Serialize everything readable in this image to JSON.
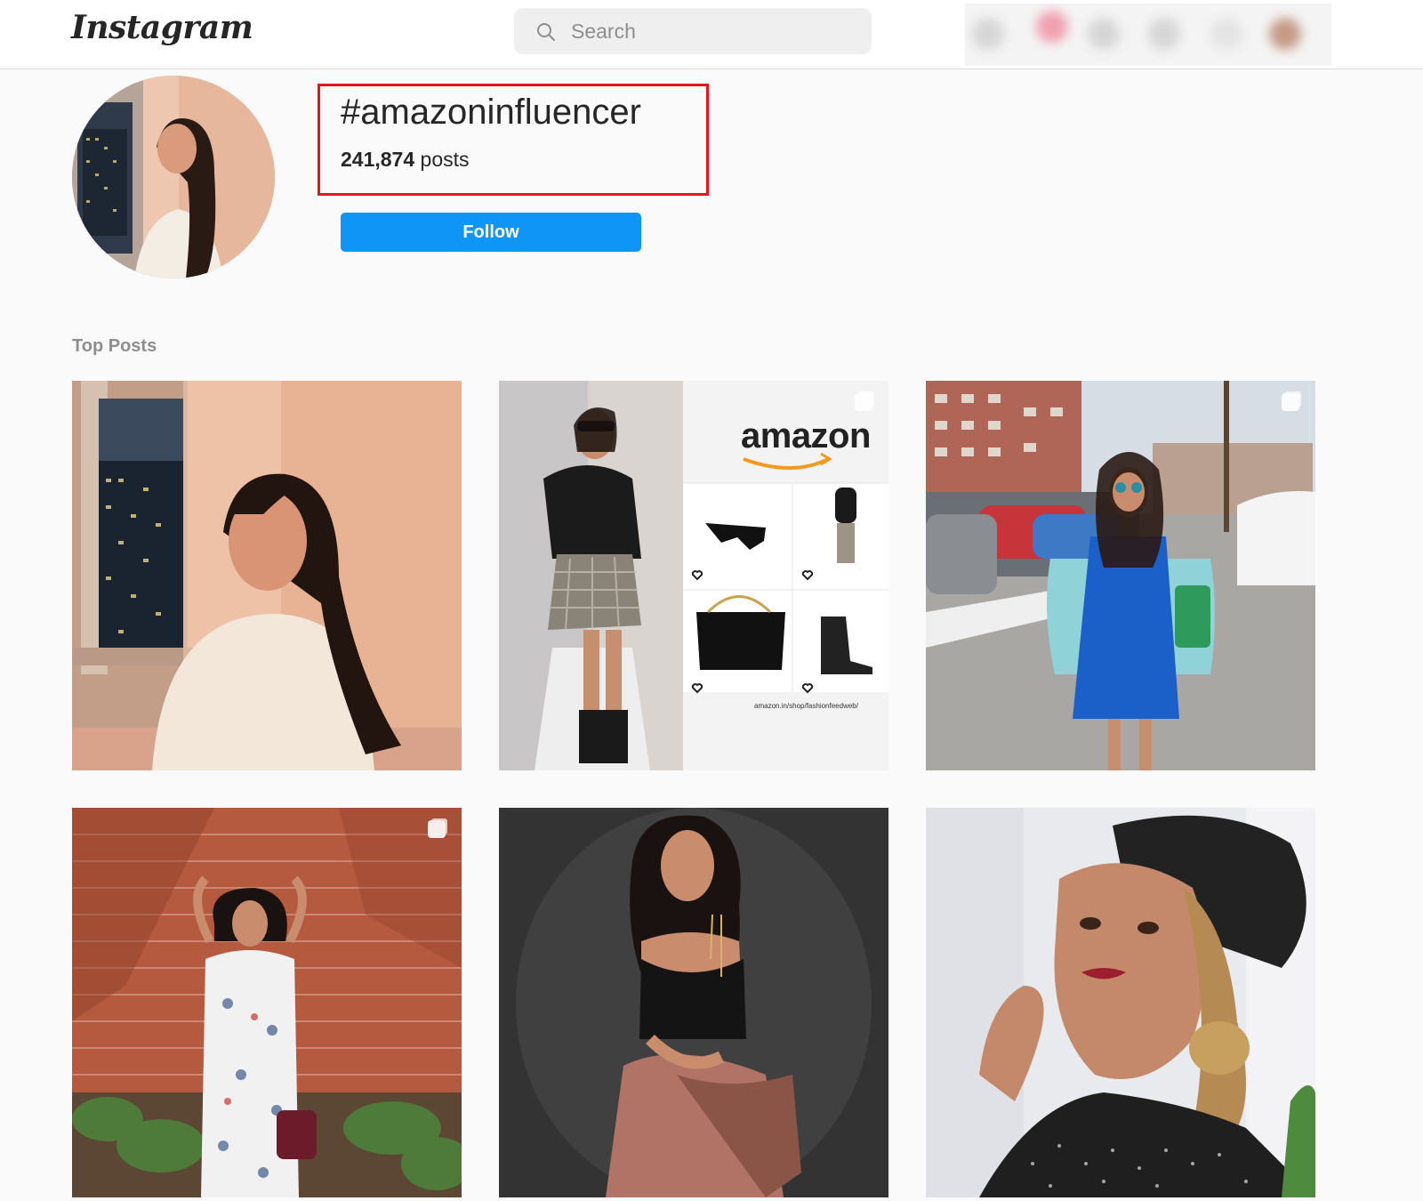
{
  "header": {
    "logo_text": "Instagram",
    "search": {
      "placeholder": "Search",
      "value": ""
    },
    "nav_icons": [
      "home-icon",
      "messages-icon",
      "new-post-icon",
      "explore-icon",
      "activity-icon",
      "profile-avatar"
    ]
  },
  "hashtag": {
    "name": "#amazoninfluencer",
    "posts_count": "241,874",
    "posts_label": "posts",
    "follow_label": "Follow"
  },
  "colors": {
    "follow_button": "#0f95f6",
    "highlight_box": "#e8141b",
    "background": "#fafafa"
  },
  "top_posts": {
    "title": "Top Posts",
    "posts": [
      {
        "multi": false
      },
      {
        "multi": true,
        "brand_text": "amazon",
        "shop_url": "amazon.in/shop/fashionfeedweb/"
      },
      {
        "multi": true
      },
      {
        "multi": true
      },
      {
        "multi": false
      },
      {
        "multi": false
      }
    ]
  }
}
